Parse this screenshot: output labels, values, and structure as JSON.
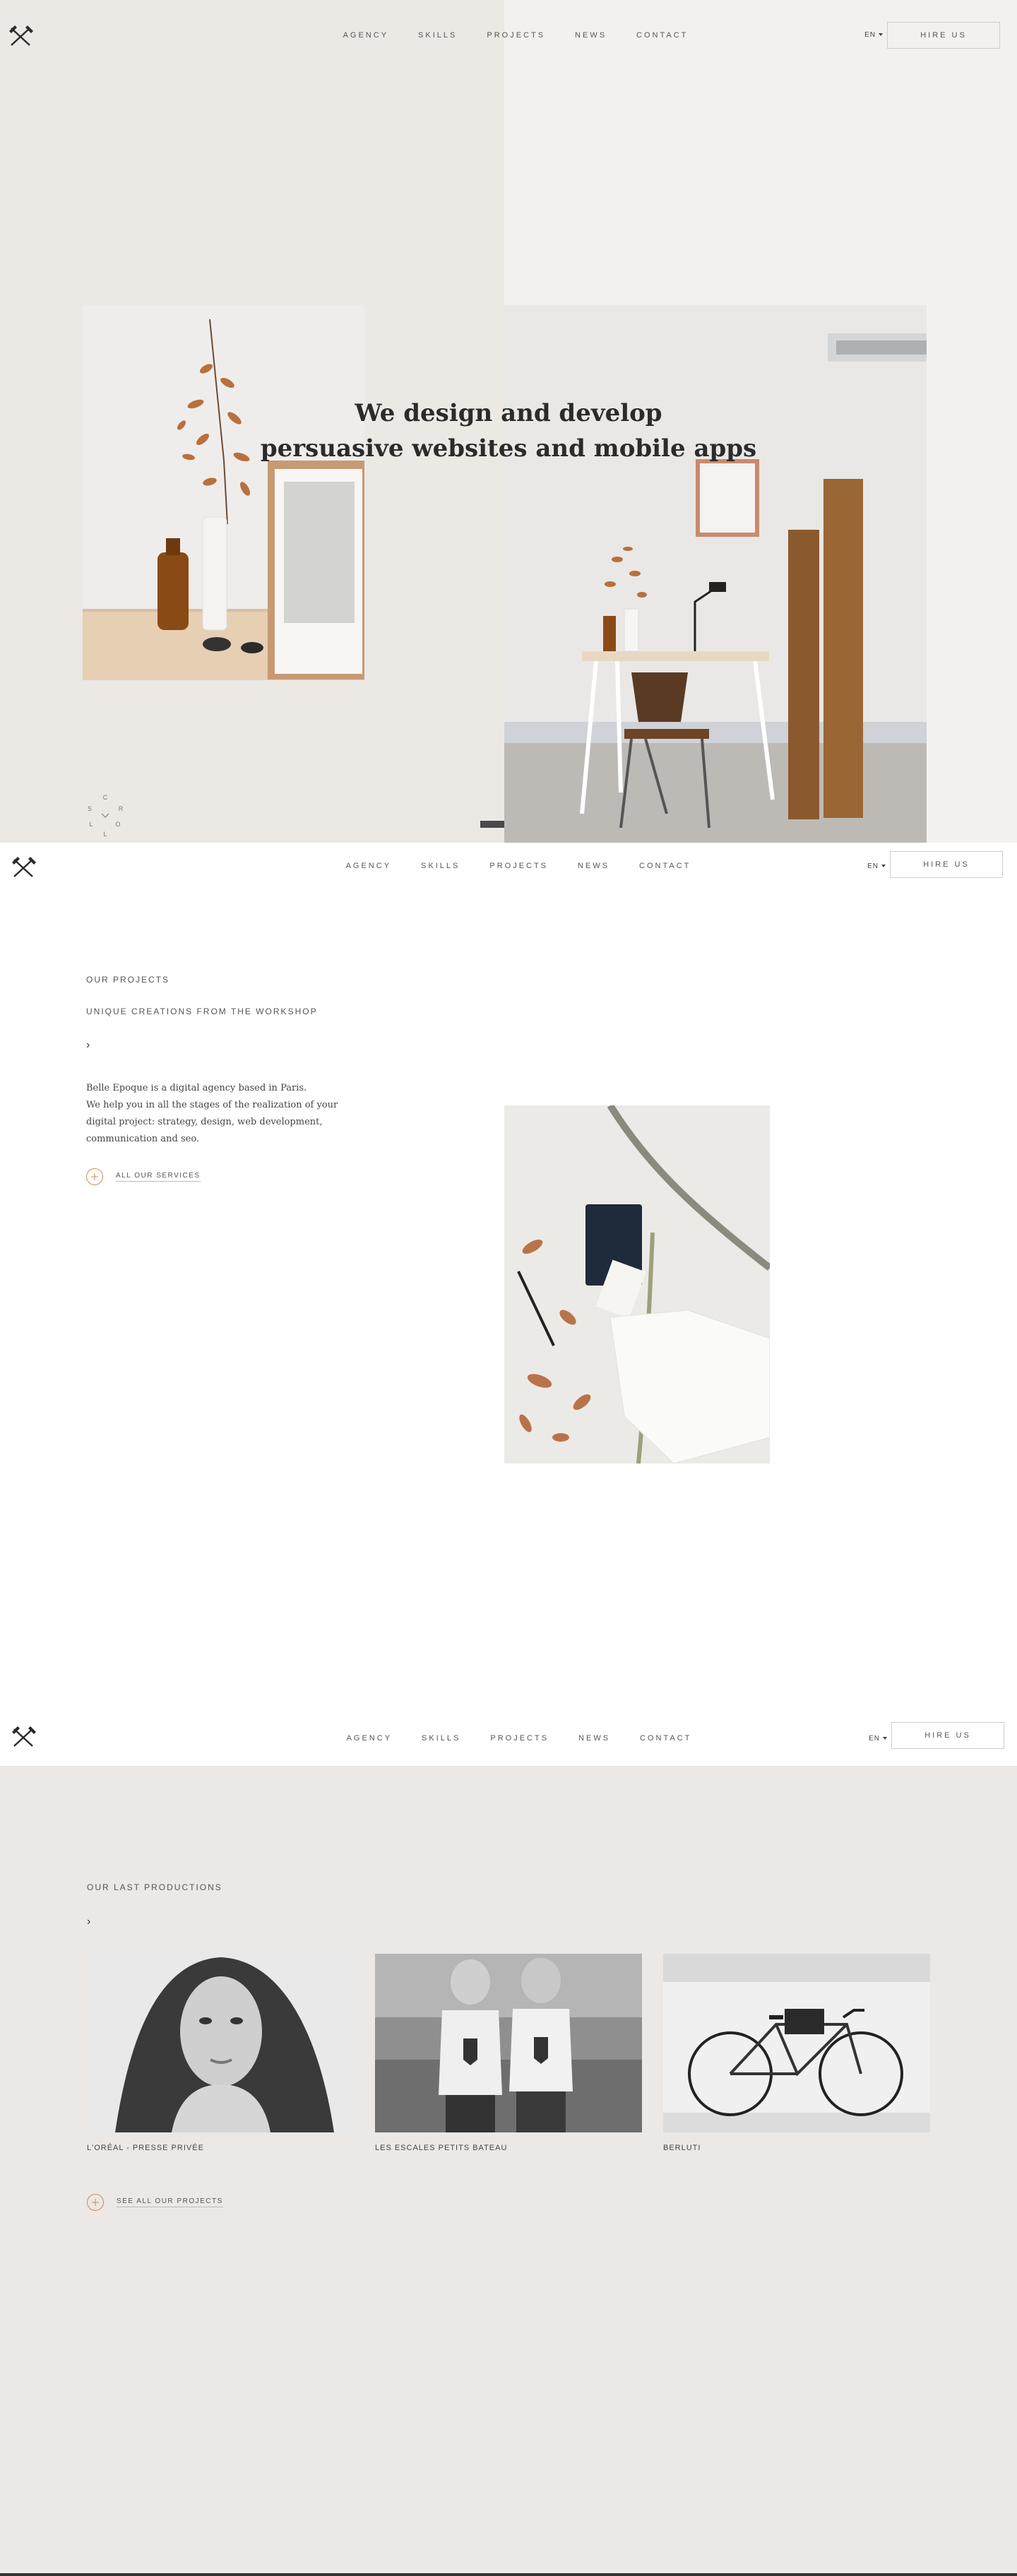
{
  "nav": {
    "menu": [
      "AGENCY",
      "SKILLS",
      "PROJECTS",
      "NEWS",
      "CONTACT"
    ],
    "lang": "EN",
    "hire": "HIRE US"
  },
  "hero": {
    "title_line1": "We design and develop",
    "title_line2": "persuasive websites and mobile apps",
    "scroll_letters": [
      "S",
      "C",
      "R",
      "O",
      "L",
      "L"
    ]
  },
  "projects": {
    "label": "OUR PROJECTS",
    "subtitle": "UNIQUE CREATIONS FROM THE WORKSHOP",
    "arrow": "›",
    "description_lines": [
      "Belle Epoque is a digital agency based in Paris.",
      "We help you in all the stages of the realization of your",
      "digital project: strategy, design, web development,",
      "communication and seo."
    ],
    "link": "ALL OUR SERVICES"
  },
  "productions": {
    "label": "OUR LAST PRODUCTIONS",
    "arrow": "›",
    "items": [
      {
        "caption": "L'ORÉAL - PRESSE PRIVÉE"
      },
      {
        "caption": "LES ESCALES PETITS BATEAU"
      },
      {
        "caption": "BERLUTI"
      }
    ],
    "link": "SEE ALL OUR PROJECTS"
  },
  "colors": {
    "accent": "#d08a5a",
    "hero_bg": "#f3f1ef",
    "hero_left_bg": "#ece8e4",
    "productions_bg": "#ebe8e5"
  }
}
